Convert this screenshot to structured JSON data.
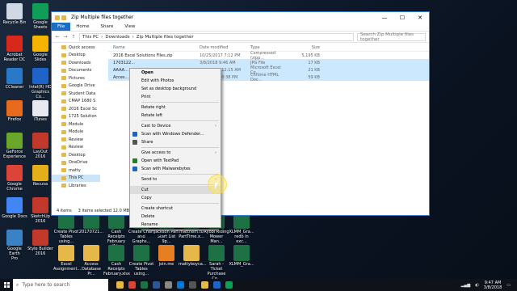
{
  "desktop": {
    "icons": [
      {
        "label": "Recycle Bin",
        "color": "#cfd8e3"
      },
      {
        "label": "Google\nSheets",
        "color": "#0f9d58"
      },
      {
        "label": "Acrobat\nReader DC",
        "color": "#d7281c"
      },
      {
        "label": "Google\nSlides",
        "color": "#f4b400"
      },
      {
        "label": "CCleaner",
        "color": "#2a78c8"
      },
      {
        "label": "Intel(R) HD\nGraphics Co...",
        "color": "#1e64c8"
      },
      {
        "label": "Firefox",
        "color": "#e86a1c"
      },
      {
        "label": "iTunes",
        "color": "#e8e8f0"
      },
      {
        "label": "GeForce\nExperience",
        "color": "#6aa62a"
      },
      {
        "label": "LayOut 2016",
        "color": "#c0392b"
      },
      {
        "label": "Google\nChrome",
        "color": "#db4437"
      },
      {
        "label": "Recuva",
        "color": "#e4b01a"
      },
      {
        "label": "Google Docs",
        "color": "#4285f4"
      },
      {
        "label": "SketchUp\n2016",
        "color": "#c0392b"
      },
      {
        "label": "Google Earth\nPro",
        "color": "#3b82c4"
      },
      {
        "label": "Style Builder\n2016",
        "color": "#c0392b"
      }
    ],
    "bottom_row_1": [
      {
        "label": "Create Pivot\nTables using...",
        "color": "#1e7145"
      },
      {
        "label": "20170721...",
        "color": "#1e7145"
      },
      {
        "label": "Cash Receipts\nFebruary (1)...",
        "color": "#1e7145"
      },
      {
        "label": "Create Chart\nand Graphs...",
        "color": "#1e7145"
      },
      {
        "label": "Jackson Part\nStart List 9p...",
        "color": "#1e7145"
      },
      {
        "label": "mattnem.tu\nPartTime.x...",
        "color": "#1e7145"
      },
      {
        "label": "Ryobi Riding\nMower Man...",
        "color": "#1e7145"
      },
      {
        "label": "XLMM_Gra...\nredo in exc...",
        "color": "#1e7145"
      }
    ],
    "bottom_row_2": [
      {
        "label": "Excel\nAssignment...",
        "color": "#e6b84a"
      },
      {
        "label": "Access\nDatabase Pr...",
        "color": "#e6b84a"
      },
      {
        "label": "Cash Receipts\nFebruary.xlsx",
        "color": "#1e7145"
      },
      {
        "label": "Create Pivot\nTables using...",
        "color": "#1e7145"
      },
      {
        "label": "join.me",
        "color": "#e67e22"
      },
      {
        "label": "mattyboyca...",
        "color": "#e6b84a"
      },
      {
        "label": "Sarah - Ticket\nPurchase Co...",
        "color": "#1e7145"
      },
      {
        "label": "XLMM_Gra...",
        "color": "#1e7145"
      }
    ]
  },
  "window": {
    "title": "Zip Multiple files together",
    "controls": {
      "min": "—",
      "max": "☐",
      "close": "✕"
    },
    "ribbon_tabs": [
      "File",
      "Home",
      "Share",
      "View"
    ],
    "address": {
      "root": "This PC",
      "p1": "Downloads",
      "p2": "Zip Multiple files together"
    },
    "search_placeholder": "Search Zip Multiple files together",
    "columns": {
      "name": "Name",
      "date": "Date modified",
      "type": "Type",
      "size": "Size"
    },
    "files": [
      {
        "name": "2016 Excel Solutions Files.zip",
        "date": "10/25/2017 7:12 PM",
        "type": "Compressed (zipp...",
        "size": "5,195 KB",
        "sel": false
      },
      {
        "name": "1703122...",
        "date": "3/8/2018 9:46 AM",
        "type": "JPG File",
        "size": "17 KB",
        "sel": true
      },
      {
        "name": "AAAA...",
        "date": "2/24/2018 12:15 AM",
        "type": "Microsoft Excel Co...",
        "size": "21 KB",
        "sel": true
      },
      {
        "name": "Acces...",
        "date": "2/8/2018 10:38 PM",
        "type": "Chrome HTML Doc...",
        "size": "59 KB",
        "sel": true
      }
    ],
    "nav_items": [
      {
        "label": "Quick access",
        "sel": false
      },
      {
        "label": "Desktop",
        "sel": false
      },
      {
        "label": "Downloads",
        "sel": false
      },
      {
        "label": "Documents",
        "sel": false
      },
      {
        "label": "Pictures",
        "sel": false
      },
      {
        "label": "Google Drive",
        "sel": false
      },
      {
        "label": "Student Data",
        "sel": false
      },
      {
        "label": "CMAP 1680 S",
        "sel": false
      },
      {
        "label": "2016 Excel Sc",
        "sel": false
      },
      {
        "label": "1725 Solution",
        "sel": false
      },
      {
        "label": "Module",
        "sel": false
      },
      {
        "label": "Module",
        "sel": false
      },
      {
        "label": "Review",
        "sel": false
      },
      {
        "label": "Review",
        "sel": false
      },
      {
        "label": "Desktop",
        "sel": false
      },
      {
        "label": "OneDrive",
        "sel": false
      },
      {
        "label": "matty",
        "sel": false
      },
      {
        "label": "This PC",
        "sel": true
      },
      {
        "label": "Libraries",
        "sel": false
      }
    ],
    "status": {
      "items": "4 items",
      "selected": "3 items selected  12.0 MB"
    }
  },
  "context_menu": {
    "groups": [
      [
        {
          "label": "Open",
          "bold": true
        },
        {
          "label": "Edit with Photos"
        },
        {
          "label": "Set as desktop background"
        },
        {
          "label": "Print"
        }
      ],
      [
        {
          "label": "Rotate right"
        },
        {
          "label": "Rotate left"
        }
      ],
      [
        {
          "label": "Cast to Device",
          "arrow": true
        },
        {
          "label": "Scan with Windows Defender...",
          "icon": "#1e64c8"
        },
        {
          "label": "Share",
          "icon": "#555"
        }
      ],
      [
        {
          "label": "Give access to",
          "arrow": true
        },
        {
          "label": "Open with TextPad",
          "icon": "#2a7a2a"
        },
        {
          "label": "Scan with Malwarebytes",
          "icon": "#1e64c8"
        }
      ],
      [
        {
          "label": "Send to",
          "arrow": true
        }
      ],
      [
        {
          "label": "Cut",
          "hl": true
        },
        {
          "label": "Copy"
        }
      ],
      [
        {
          "label": "Create shortcut"
        },
        {
          "label": "Delete"
        },
        {
          "label": "Rename"
        }
      ],
      [
        {
          "label": "Properties"
        }
      ]
    ]
  },
  "taskbar": {
    "search_placeholder": "Type here to search",
    "apps": [
      "#e6b84a",
      "#db4437",
      "#1e7145",
      "#2b579a",
      "#888",
      "#0078d7",
      "#555",
      "#e6b84a",
      "#1e64c8",
      "#0f9d58"
    ],
    "time": "9:47 AM",
    "date": "3/8/2018"
  }
}
